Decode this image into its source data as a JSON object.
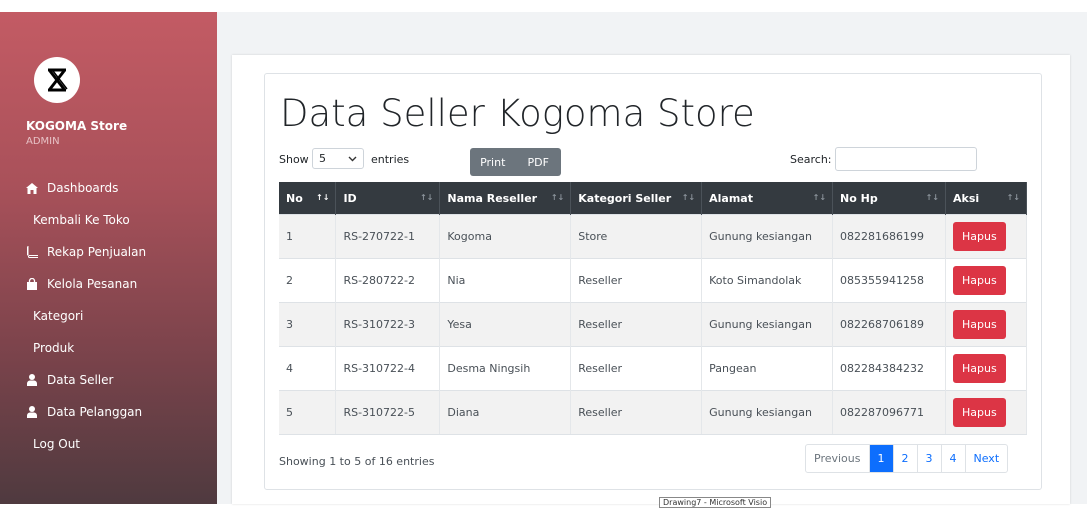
{
  "sidebar": {
    "store_name": "KOGOMA Store",
    "role": "ADMIN",
    "items": [
      {
        "label": "Dashboards",
        "icon": "home-icon"
      },
      {
        "label": "Kembali Ke Toko",
        "icon": ""
      },
      {
        "label": "Rekap Penjualan",
        "icon": "book-icon"
      },
      {
        "label": "Kelola Pesanan",
        "icon": "shopping-bag-icon"
      },
      {
        "label": "Kategori",
        "icon": ""
      },
      {
        "label": "Produk",
        "icon": ""
      },
      {
        "label": "Data Seller",
        "icon": "user-icon"
      },
      {
        "label": "Data Pelanggan",
        "icon": "user-icon"
      },
      {
        "label": "Log Out",
        "icon": ""
      }
    ]
  },
  "page": {
    "title": "Data Seller Kogoma Store",
    "show_label": "Show",
    "page_size": "5",
    "entries_label": "entries",
    "print_label": "Print",
    "pdf_label": "PDF",
    "search_label": "Search:",
    "search_value": ""
  },
  "table": {
    "headers": [
      "No",
      "ID",
      "Nama Reseller",
      "Kategori Seller",
      "Alamat",
      "No Hp",
      "Aksi"
    ],
    "action_label": "Hapus",
    "rows": [
      [
        "1",
        "RS-270722-1",
        "Kogoma",
        "Store",
        "Gunung kesiangan",
        "082281686199"
      ],
      [
        "2",
        "RS-280722-2",
        "Nia",
        "Reseller",
        "Koto Simandolak",
        "085355941258"
      ],
      [
        "3",
        "RS-310722-3",
        "Yesa",
        "Reseller",
        "Gunung kesiangan",
        "082268706189"
      ],
      [
        "4",
        "RS-310722-4",
        "Desma Ningsih",
        "Reseller",
        "Pangean",
        "082284384232"
      ],
      [
        "5",
        "RS-310722-5",
        "Diana",
        "Reseller",
        "Gunung kesiangan",
        "082287096771"
      ]
    ]
  },
  "footer": {
    "info": "Showing 1 to 5 of 16 entries",
    "pagination": {
      "previous": "Previous",
      "pages": [
        "1",
        "2",
        "3",
        "4"
      ],
      "active": "1",
      "next": "Next"
    }
  },
  "taskbar_tooltip": "Drawing7 - Microsoft Visio",
  "colors": {
    "header_bg": "#343a40",
    "danger": "#dc3545",
    "primary": "#0d6efd",
    "sidebar_top": "#c35b64"
  }
}
